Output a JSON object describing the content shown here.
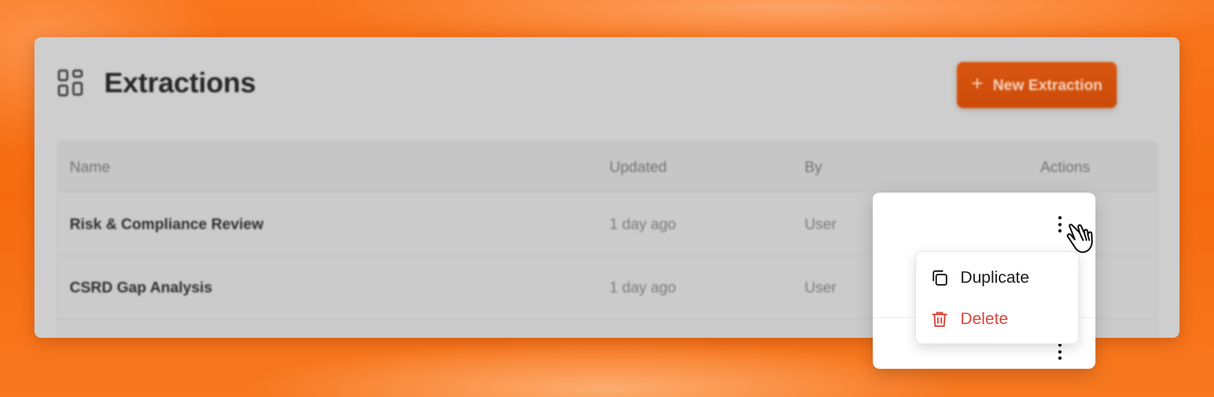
{
  "header": {
    "title": "Extractions",
    "title_icon": "grid-icon",
    "new_button_label": "New Extraction",
    "new_button_icon": "plus-icon"
  },
  "table": {
    "columns": [
      "Name",
      "Updated",
      "By",
      "Actions"
    ],
    "rows": [
      {
        "name": "Risk & Compliance Review",
        "updated": "1 day ago",
        "by": "User"
      },
      {
        "name": "CSRD Gap Analysis",
        "updated": "1 day ago",
        "by": "User"
      }
    ]
  },
  "menu": {
    "items": [
      {
        "label": "Duplicate",
        "icon": "copy-icon"
      },
      {
        "label": "Delete",
        "icon": "trash-icon",
        "color": "#d84a43"
      }
    ]
  },
  "colors": {
    "background": "#f66b0f",
    "accent_button": "#d95610",
    "danger": "#d84a43"
  }
}
